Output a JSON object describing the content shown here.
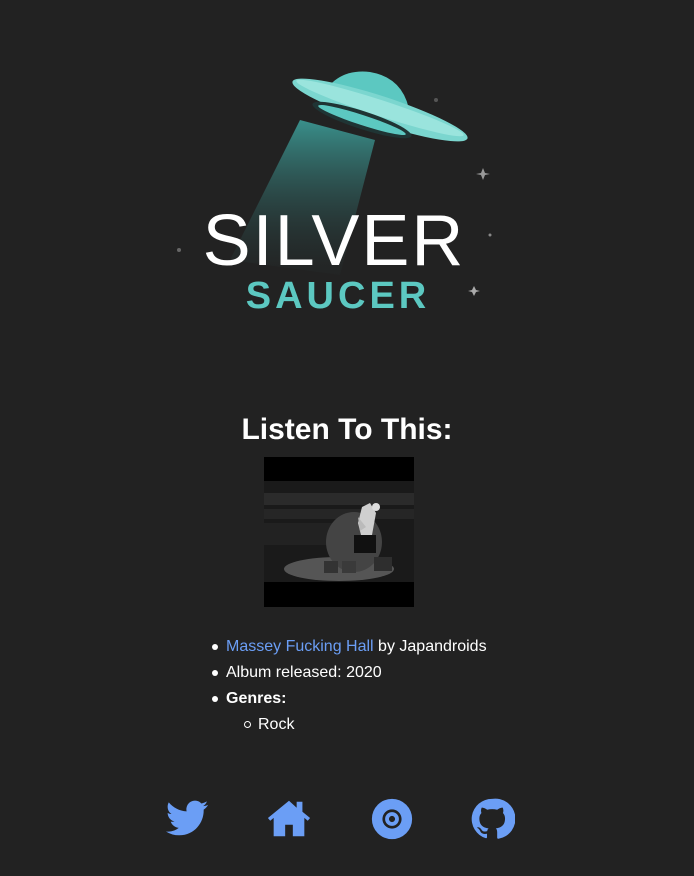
{
  "logo": {
    "line1": "SILVER",
    "line2": "SAUCER",
    "accent_color": "#5cc8c1"
  },
  "heading": "Listen To This:",
  "album": {
    "title": "Massey Fucking Hall",
    "by_text": " by Japandroids",
    "released_label": "Album released: 2020",
    "genres_label": "Genres:",
    "genres": [
      "Rock"
    ]
  },
  "social": {
    "icons": [
      "twitter-icon",
      "home-icon",
      "record-icon",
      "github-icon"
    ],
    "color": "#6b9ef5"
  }
}
